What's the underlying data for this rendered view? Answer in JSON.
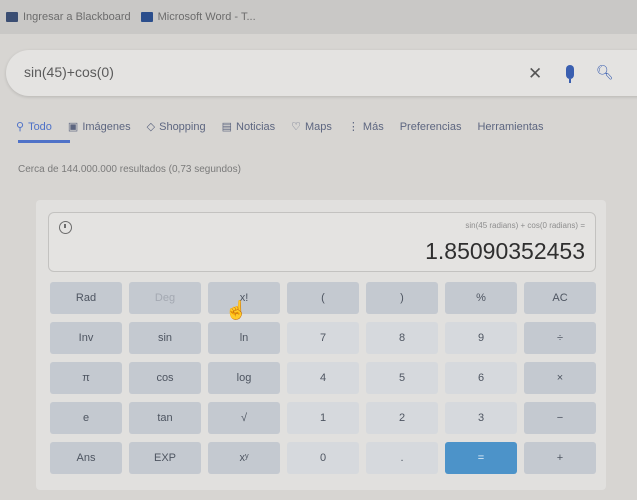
{
  "bookmarks": [
    {
      "label": "Ingresar a Blackboard",
      "icon": "blackboard-icon"
    },
    {
      "label": "Microsoft Word - T...",
      "icon": "word-icon"
    }
  ],
  "search": {
    "query": "sin(45)+cos(0)"
  },
  "tabs": [
    {
      "label": "Todo",
      "icon": "search-icon",
      "active": true
    },
    {
      "label": "Imágenes",
      "icon": "image-icon"
    },
    {
      "label": "Shopping",
      "icon": "tag-icon"
    },
    {
      "label": "Noticias",
      "icon": "news-icon"
    },
    {
      "label": "Maps",
      "icon": "map-pin-icon"
    },
    {
      "label": "Más",
      "icon": "more-icon"
    },
    {
      "label": "Preferencias"
    },
    {
      "label": "Herramientas"
    }
  ],
  "results_count": "Cerca de 144.000.000 resultados (0,73 segundos)",
  "calculator": {
    "expression": "sin(45 radians) + cos(0 radians) =",
    "result": "1.85090352453",
    "keys": [
      [
        "Rad",
        "Deg",
        "x!",
        "(",
        ")",
        "%",
        "AC"
      ],
      [
        "Inv",
        "sin",
        "ln",
        "7",
        "8",
        "9",
        "÷"
      ],
      [
        "π",
        "cos",
        "log",
        "4",
        "5",
        "6",
        "×"
      ],
      [
        "e",
        "tan",
        "√",
        "1",
        "2",
        "3",
        "−"
      ],
      [
        "Ans",
        "EXP",
        "xʸ",
        "0",
        ".",
        "=",
        "+"
      ]
    ]
  }
}
